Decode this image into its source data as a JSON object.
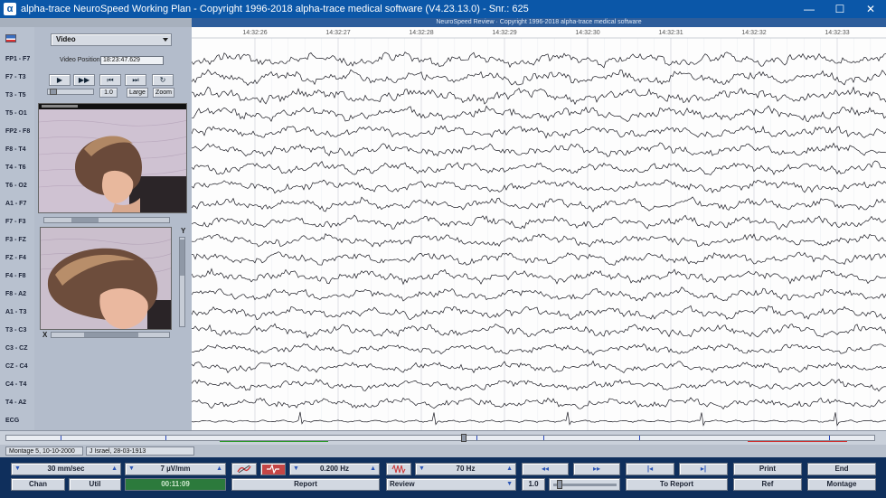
{
  "window": {
    "title": "alpha-trace NeuroSpeed Working Plan - Copyright 1996-2018 alpha-trace medical software (V4.23.13.0) - Snr.: 625",
    "icon": "α",
    "controls": {
      "minimize": "—",
      "maximize": "☐",
      "close": "✕"
    }
  },
  "subheader": "NeuroSpeed Review · Copyright 1996-2018 alpha-trace medical software",
  "channels": [
    "FP1 - F7",
    "F7 - T3",
    "T3 - T5",
    "T5 - O1",
    "FP2 - F8",
    "F8 - T4",
    "T4 - T6",
    "T6 - O2",
    "A1 - F7",
    "F7 - F3",
    "F3 - FZ",
    "FZ - F4",
    "F4 - F8",
    "F8 - A2",
    "A1 - T3",
    "T3 - C3",
    "C3 - CZ",
    "CZ - C4",
    "C4 - T4",
    "T4 - A2",
    "ECG"
  ],
  "video": {
    "selector": "Video",
    "position_label": "Video Position:",
    "position_value": "18:23:47.629",
    "buttons": {
      "play": "▶",
      "fast_forward": "▶▶",
      "skip_back": "⏮",
      "skip_forward": "⏭",
      "refresh": "↻"
    },
    "speed": "1.0",
    "large": "Large",
    "zoom": "Zoom",
    "axis_y": "Y",
    "axis_x": "X"
  },
  "timeline_labels": [
    "14:32:26",
    "14:32:27",
    "14:32:28",
    "14:32:29",
    "14:32:30",
    "14:32:31",
    "14:32:32",
    "14:32:33"
  ],
  "status": {
    "montage": "Montage 5, 10-10-2000",
    "patient": "J Israel, 28-03-1913"
  },
  "controls": {
    "speed": "30 mm/sec",
    "sensitivity": "7 µV/mm",
    "low_filter": "0.200 Hz",
    "high_filter": "70 Hz",
    "print": "Print",
    "end": "End",
    "chan": "Chan",
    "util": "Util",
    "elapsed": "00:11:09",
    "report": "Report",
    "review": "Review",
    "rate": "1.0",
    "to_report": "To Report",
    "ref": "Ref",
    "montage": "Montage",
    "prev_page": "◂◂",
    "next_page": "▸▸",
    "first": "|◂",
    "last": "▸|",
    "down_arrow": "▼",
    "up_arrow": "▲"
  }
}
